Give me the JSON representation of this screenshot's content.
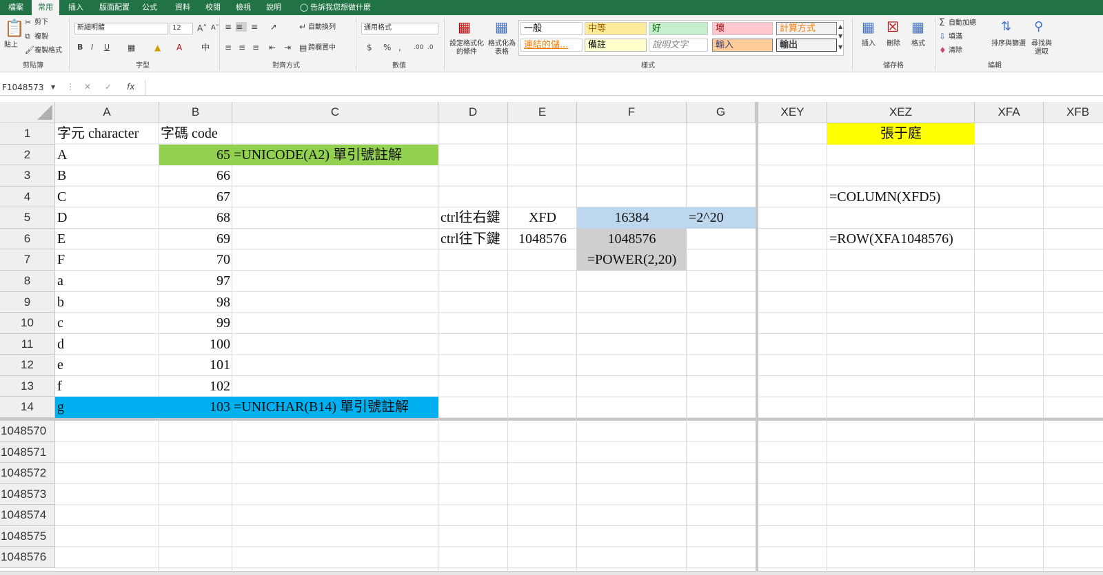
{
  "tabs": [
    "檔案",
    "常用",
    "插入",
    "版面配置",
    "公式",
    "資料",
    "校閱",
    "檢視",
    "說明",
    "告訴我您想做什麼"
  ],
  "ribbon": {
    "clipboard": {
      "paste": "貼上",
      "cut": "剪下",
      "copy": "複製",
      "format_painter": "複製格式",
      "label": "剪貼簿"
    },
    "font": {
      "name": "新細明體",
      "size": "12",
      "bold": "B",
      "italic": "I",
      "underline": "U",
      "label": "字型"
    },
    "align": {
      "wrap": "自動換列",
      "merge": "跨欄置中",
      "label": "對齊方式"
    },
    "number": {
      "format": "通用格式",
      "currency": "$",
      "percent": "%",
      "comma": ",",
      "label": "數值"
    },
    "styles": {
      "cond": "設定格式化的條件",
      "table": "格式化為表格",
      "label": "樣式",
      "cells": [
        {
          "text": "一般",
          "bg": "#ffffff",
          "fg": "#000000"
        },
        {
          "text": "中等",
          "bg": "#ffeb9c",
          "fg": "#9c6500"
        },
        {
          "text": "好",
          "bg": "#c6efce",
          "fg": "#006100"
        },
        {
          "text": "壞",
          "bg": "#ffc7ce",
          "fg": "#9c0006"
        },
        {
          "text": "計算方式",
          "bg": "#f2f2f2",
          "fg": "#fa7d00"
        },
        {
          "text": "連結的儲...",
          "bg": "#ffffff",
          "fg": "#fa7d00"
        },
        {
          "text": "備註",
          "bg": "#ffffcc",
          "fg": "#000000"
        },
        {
          "text": "說明文字",
          "bg": "#ffffff",
          "fg": "#7f7f7f"
        },
        {
          "text": "輸入",
          "bg": "#ffcc99",
          "fg": "#3f3f76"
        },
        {
          "text": "輸出",
          "bg": "#f2f2f2",
          "fg": "#3f3f3f"
        }
      ]
    },
    "cells_group": {
      "insert": "插入",
      "delete": "刪除",
      "format": "格式",
      "label": "儲存格"
    },
    "editing": {
      "autosum": "自動加總",
      "fill": "填滿",
      "clear": "清除",
      "sort": "排序與篩選",
      "find": "尋找與選取",
      "label": "編輯"
    }
  },
  "formula_bar": {
    "name_box": "F1048573",
    "fx": "fx",
    "content": ""
  },
  "columns": [
    "A",
    "B",
    "C",
    "D",
    "E",
    "F",
    "G",
    "XEY",
    "XEZ",
    "XFA",
    "XFB"
  ],
  "rows": [
    "1",
    "2",
    "3",
    "4",
    "5",
    "6",
    "7",
    "8",
    "9",
    "10",
    "11",
    "12",
    "13",
    "14",
    "1048570",
    "1048571",
    "1048572",
    "1048573",
    "1048574",
    "1048575",
    "1048576"
  ],
  "colors": {
    "green": "#92d050",
    "blue": "#00b0f0",
    "lightblue": "#bdd7ee",
    "gray": "#d0cece",
    "yellow": "#ffff00",
    "accent": "#217346"
  },
  "cells": {
    "A1": "字元 character",
    "B1": "字碼 code",
    "A": [
      "A",
      "B",
      "C",
      "D",
      "E",
      "F",
      "a",
      "b",
      "c",
      "d",
      "e",
      "f",
      "g"
    ],
    "B": [
      "65",
      "66",
      "67",
      "68",
      "69",
      "70",
      "97",
      "98",
      "99",
      "100",
      "101",
      "102",
      "103"
    ],
    "C2": "=UNICODE(A2) 單引號註解",
    "C14": "=UNICHAR(B14) 單引號註解",
    "D5": "ctrl往右鍵",
    "E5": "XFD",
    "F5": "16384",
    "G5": "=2^20",
    "D6": "ctrl往下鍵",
    "E6": "1048576",
    "F6": "1048576",
    "F7": "=POWER(2,20)",
    "XEZ1": "張于庭",
    "XEZ4": "=COLUMN(XFD5)",
    "XEZ6": "=ROW(XFA1048576)"
  }
}
